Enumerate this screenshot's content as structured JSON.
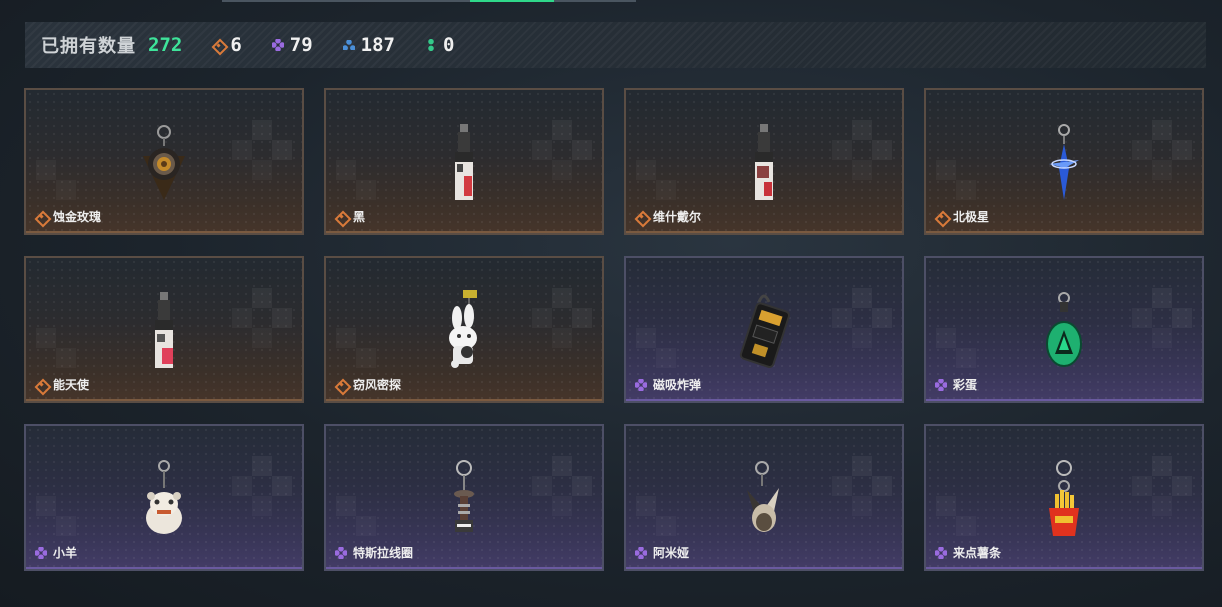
{
  "header": {
    "title": "已拥有数量",
    "total": "272",
    "counts": [
      {
        "icon": "orange-diamond-icon",
        "value": "6",
        "color": "#d97a3a"
      },
      {
        "icon": "purple-quad-icon",
        "value": "79",
        "color": "#9a6be0"
      },
      {
        "icon": "blue-tri-icon",
        "value": "187",
        "color": "#4a8fd8"
      },
      {
        "icon": "green-duo-icon",
        "value": "0",
        "color": "#34c98a"
      }
    ]
  },
  "items": [
    {
      "name": "蚀金玫瑰",
      "rarity": "orange",
      "icon": "gold-rose-charm-icon"
    },
    {
      "name": "黑",
      "rarity": "orange",
      "icon": "black-tag-charm-icon"
    },
    {
      "name": "维什戴尔",
      "rarity": "orange",
      "icon": "wisdel-tag-charm-icon"
    },
    {
      "name": "北极星",
      "rarity": "orange",
      "icon": "north-star-charm-icon"
    },
    {
      "name": "能天使",
      "rarity": "orange",
      "icon": "exusiai-tag-charm-icon"
    },
    {
      "name": "窃风密探",
      "rarity": "orange",
      "icon": "rabbit-spy-charm-icon"
    },
    {
      "name": "磁吸炸弹",
      "rarity": "purple",
      "icon": "magnet-bomb-charm-icon"
    },
    {
      "name": "彩蛋",
      "rarity": "purple",
      "icon": "easter-egg-charm-icon"
    },
    {
      "name": "小羊",
      "rarity": "purple",
      "icon": "lamb-charm-icon"
    },
    {
      "name": "特斯拉线圈",
      "rarity": "purple",
      "icon": "tesla-coil-charm-icon"
    },
    {
      "name": "阿米娅",
      "rarity": "purple",
      "icon": "amiya-charm-icon"
    },
    {
      "name": "来点薯条",
      "rarity": "purple",
      "icon": "fries-charm-icon"
    }
  ],
  "colors": {
    "accent_green": "#3ee39a",
    "rarity_orange": "#d97a3a",
    "rarity_purple": "#9a6be0"
  }
}
